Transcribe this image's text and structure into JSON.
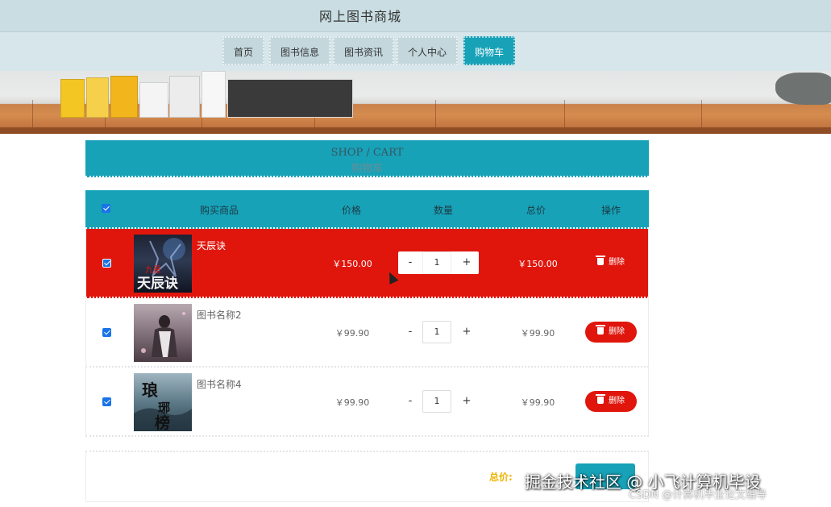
{
  "header": {
    "site_title": "网上图书商城"
  },
  "nav": {
    "items": [
      {
        "label": "首页",
        "active": false
      },
      {
        "label": "图书信息",
        "active": false
      },
      {
        "label": "图书资讯",
        "active": false
      },
      {
        "label": "个人中心",
        "active": false
      },
      {
        "label": "购物车",
        "active": true
      }
    ]
  },
  "cart_heading": {
    "en": "SHOP / CART",
    "zh": "购物车"
  },
  "table": {
    "columns": [
      "购买商品",
      "价格",
      "数量",
      "总价",
      "操作"
    ],
    "select_all_checked": true,
    "rows": [
      {
        "checked": true,
        "name": "天辰诀",
        "cover_text": "天辰诀",
        "cover_top": "九星",
        "price": "￥150.00",
        "quantity": "1",
        "total": "￥150.00",
        "delete_label": "删除",
        "highlighted": true
      },
      {
        "checked": true,
        "name": "图书名称2",
        "price": "￥99.90",
        "quantity": "1",
        "total": "￥99.90",
        "delete_label": "删除",
        "highlighted": false
      },
      {
        "checked": true,
        "name": "图书名称4",
        "cover_text": "琅琊榜",
        "price": "￥99.90",
        "quantity": "1",
        "total": "￥99.90",
        "delete_label": "删除",
        "highlighted": false
      }
    ],
    "qty_minus": "-",
    "qty_plus": "+"
  },
  "footer": {
    "total_label": "总价:"
  },
  "watermark": {
    "line1": "掘金技术社区 @ 小飞计算机毕设",
    "line2": "CSDN @计算机毕业论文辅导"
  },
  "colors": {
    "accent": "#17a2b8",
    "danger": "#e0160d",
    "highlight_row": "#e0160d",
    "total_label": "#f0b400"
  },
  "icons": {
    "delete": "trash-icon",
    "checkbox": "checkbox-icon"
  }
}
